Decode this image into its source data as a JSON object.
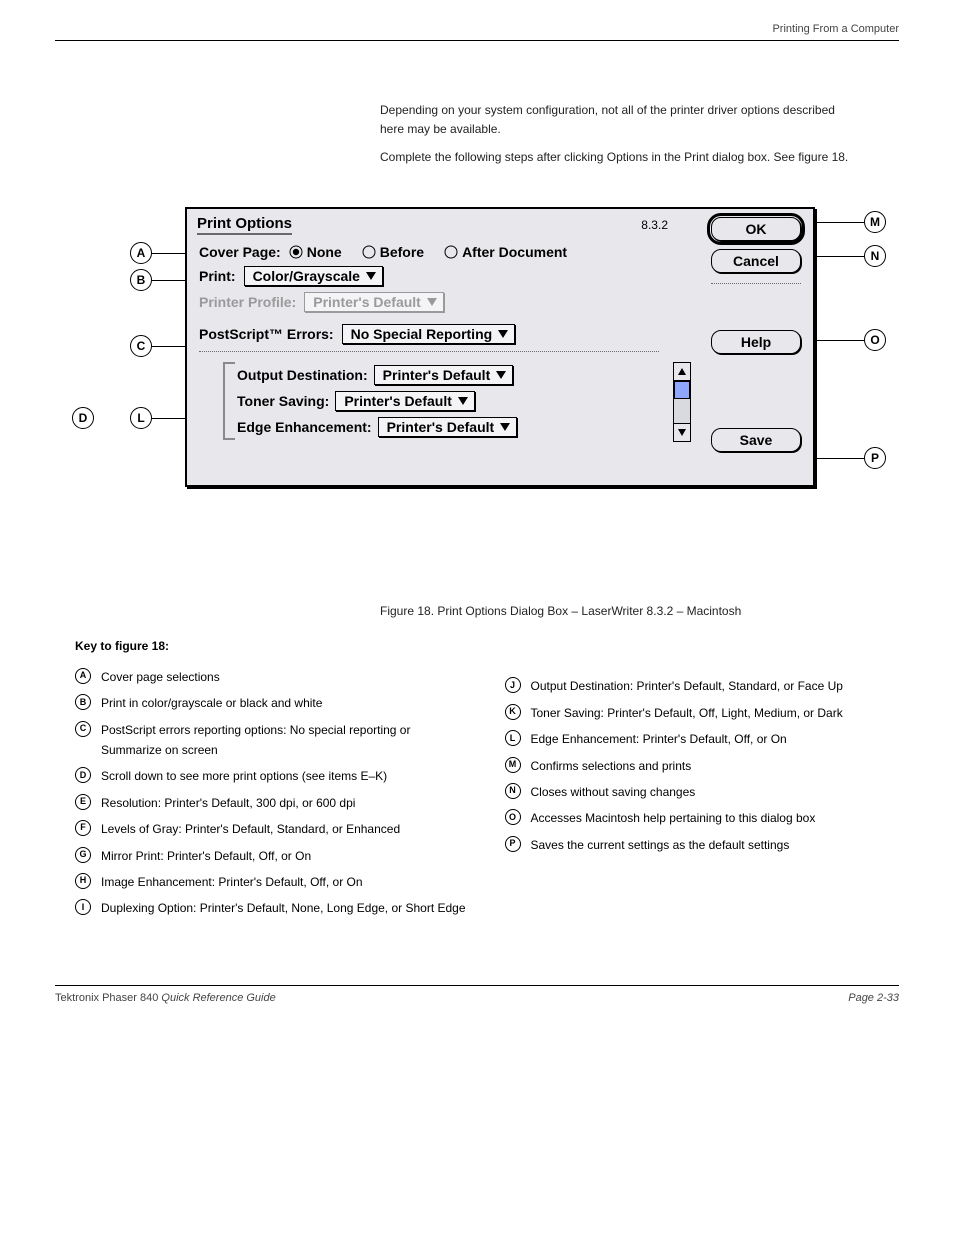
{
  "header": {
    "right": "Printing From a Computer"
  },
  "intro": {
    "p1": "Depending on your system configuration, not all of the printer driver options described here may be available.",
    "p2": "Complete the following steps after clicking Options in the Print dialog box. See figure 18."
  },
  "dialog": {
    "title": "Print Options",
    "version": "8.3.2",
    "cover_page_label": "Cover Page:",
    "cover_page_options": {
      "none": "None",
      "before": "Before",
      "after": "After Document"
    },
    "print_label": "Print:",
    "print_value": "Color/Grayscale",
    "printer_profile_label": "Printer Profile:",
    "printer_profile_value": "Printer's Default",
    "ps_errors_label": "PostScript™ Errors:",
    "ps_errors_value": "No Special Reporting",
    "output_dest_label": "Output Destination:",
    "output_dest_value": "Printer's Default",
    "toner_saving_label": "Toner Saving:",
    "toner_saving_value": "Printer's Default",
    "edge_enh_label": "Edge Enhancement:",
    "edge_enh_value": "Printer's Default",
    "buttons": {
      "ok": "OK",
      "cancel": "Cancel",
      "help": "Help",
      "save": "Save"
    }
  },
  "figure_caption": "Figure 18. Print Options Dialog Box – LaserWriter 8.3.2 – Macintosh",
  "key_header": "Key to figure 18:",
  "legend_left": [
    {
      "l": "A",
      "t": "Cover page selections"
    },
    {
      "l": "B",
      "t": "Print in color/grayscale or black and white"
    },
    {
      "l": "C",
      "t": "PostScript errors reporting options:  No special reporting or Summarize on screen"
    },
    {
      "l": "D",
      "t": "Scroll down to see more print options (see items E–K)"
    },
    {
      "l": "E",
      "t": "Resolution:  Printer's Default, 300 dpi, or 600 dpi"
    },
    {
      "l": "F",
      "t": "Levels of Gray:  Printer's Default, Standard, or Enhanced"
    },
    {
      "l": "G",
      "t": "Mirror Print:  Printer's Default, Off, or On"
    },
    {
      "l": "H",
      "t": "Image Enhancement:  Printer's Default, Off, or On"
    },
    {
      "l": "I",
      "t": "Duplexing Option:  Printer's Default, None, Long Edge, or Short Edge"
    }
  ],
  "legend_right": [
    {
      "l": "J",
      "t": "Output Destination:  Printer's Default, Standard, or Face Up"
    },
    {
      "l": "K",
      "t": "Toner Saving:  Printer's Default, Off, Light, Medium, or Dark"
    },
    {
      "l": "L",
      "t": "Edge Enhancement:  Printer's Default, Off, or On"
    },
    {
      "l": "M",
      "t": "Confirms selections and prints"
    },
    {
      "l": "N",
      "t": "Closes without saving changes"
    },
    {
      "l": "O",
      "t": "Accesses Macintosh help pertaining to this dialog box"
    },
    {
      "l": "P",
      "t": "Saves the current settings as the default settings"
    }
  ],
  "footer": {
    "left_plain": "Tektronix Phaser 840 ",
    "left_italic": "Quick Reference Guide",
    "right": "Page 2-33"
  }
}
